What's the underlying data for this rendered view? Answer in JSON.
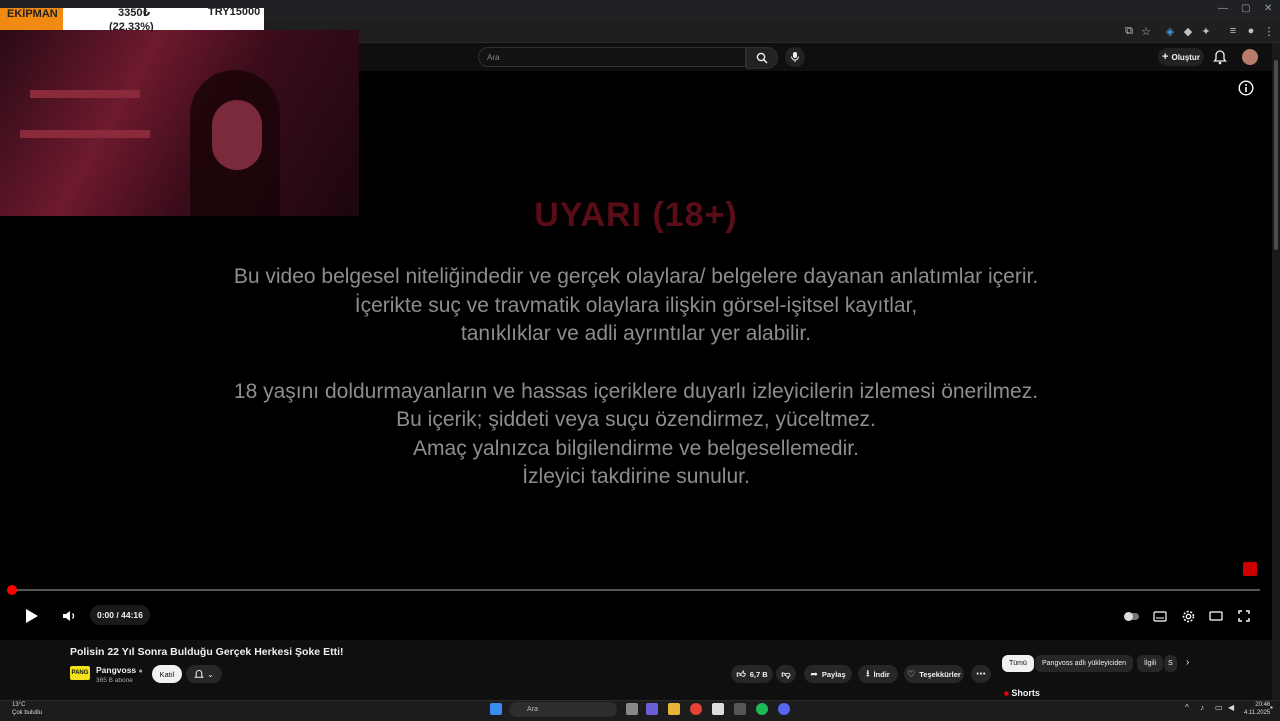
{
  "browser": {
    "window_controls": [
      "—",
      "▢",
      "✕"
    ]
  },
  "youtube_header": {
    "search_placeholder": "Ara",
    "create_label": "Oluştur"
  },
  "overlay": {
    "label": "EKİPMAN",
    "current_value": "3350₺",
    "percent": "(22.33%)",
    "goal": "TRY15000",
    "progress_fraction": 0.2233
  },
  "warning": {
    "title": "UYARI (18+)",
    "paragraph1": [
      "Bu video belgesel niteliğindedir ve gerçek olaylara/ belgelere dayanan anlatımlar içerir.",
      "İçerikte suç ve travmatik olaylara ilişkin görsel-işitsel kayıtlar,",
      "tanıklıklar ve adli ayrıntılar yer alabilir."
    ],
    "paragraph2": [
      "18 yaşını doldurmayanların ve hassas içeriklere duyarlı izleyicilerin izlemesi önerilmez.",
      "Bu içerik; şiddeti veya suçu özendirmez, yüceltmez.",
      "Amaç yalnızca bilgilendirme ve belgesellemedir.",
      "İzleyici takdirine sunulur."
    ]
  },
  "player": {
    "time": "0:00 / 44:16",
    "progress_fraction": 0.0
  },
  "video": {
    "title": "Polisin 22 Yıl Sonra Bulduğu Gerçek Herkesi Şoke Etti!",
    "channel": "Pangvoss",
    "subscribers": "365 B abone",
    "join_label": "Katıl",
    "like_count": "6,7 B",
    "share_label": "Paylaş",
    "download_label": "İndir",
    "thanks_label": "Teşekkürler"
  },
  "sidebar": {
    "chips": [
      "Tümü",
      "Pangvoss adlı yükleyiciden",
      "İlgili",
      "S"
    ],
    "shorts_label": "Shorts"
  },
  "taskbar": {
    "weather_temp": "13°C",
    "weather_desc": "Çok bulutlu",
    "search_placeholder": "Ara",
    "time": "20:46",
    "date": "4.11.2025"
  },
  "colors": {
    "accent_red": "#ff0000",
    "warning_title": "#5a0d16",
    "overlay_orange": "#f08a12"
  }
}
